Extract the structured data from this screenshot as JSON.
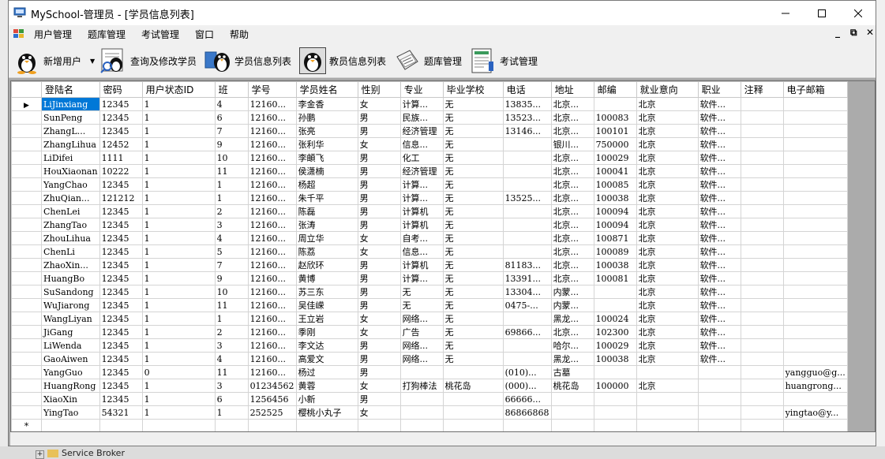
{
  "window": {
    "title": "MySchool-管理员 - [学员信息列表]"
  },
  "menu": [
    "用户管理",
    "题库管理",
    "考试管理",
    "窗口",
    "帮助"
  ],
  "mdi_controls": {
    "minimize": "_",
    "restore": "⧉",
    "close": "✕"
  },
  "toolbar": [
    {
      "label": "新增用户",
      "icon": "penguin-user-icon",
      "has_dropdown": true
    },
    {
      "label": "查询及修改学员",
      "icon": "penguin-search-icon"
    },
    {
      "label": "学员信息列表",
      "icon": "penguin-list-icon"
    },
    {
      "label": "教员信息列表",
      "icon": "penguin-teacher-icon"
    },
    {
      "label": "题库管理",
      "icon": "question-bank-icon"
    },
    {
      "label": "考试管理",
      "icon": "exam-sheet-icon"
    }
  ],
  "background": {
    "bottom_tree_item": "Service Broker"
  },
  "grid": {
    "columns": [
      "登陆名",
      "密码",
      "用户状态ID",
      "班",
      "学号",
      "学员姓名",
      "性别",
      "专业",
      "毕业学校",
      "电话",
      "地址",
      "邮编",
      "就业意向",
      "职业",
      "注释",
      "电子邮箱"
    ],
    "new_row_marker": "*",
    "current_row_marker": "▶",
    "rows": [
      [
        "LiJinxiang",
        "12345",
        "1",
        "4",
        "12160...",
        "李金香",
        "女",
        "计算...",
        "无",
        "13835...",
        "北京...",
        "",
        "北京",
        "软件...",
        "",
        ""
      ],
      [
        "SunPeng",
        "12345",
        "1",
        "6",
        "12160...",
        "孙鹏",
        "男",
        "民族...",
        "无",
        "13523...",
        "北京...",
        "100083",
        "北京",
        "软件...",
        "",
        ""
      ],
      [
        "ZhangL...",
        "12345",
        "1",
        "7",
        "12160...",
        "张亮",
        "男",
        "经济管理",
        "无",
        "13146...",
        "北京...",
        "100101",
        "北京",
        "软件...",
        "",
        ""
      ],
      [
        "ZhangLihua",
        "12452",
        "1",
        "9",
        "12160...",
        "张利华",
        "女",
        "信息...",
        "无",
        "",
        "银川...",
        "750000",
        "北京",
        "软件...",
        "",
        ""
      ],
      [
        "LiDifei",
        "1111",
        "1",
        "10",
        "12160...",
        "李頔飞",
        "男",
        "化工",
        "无",
        "",
        "北京...",
        "100029",
        "北京",
        "软件...",
        "",
        ""
      ],
      [
        "HouXiaonan",
        "10222",
        "1",
        "11",
        "12160...",
        "侯潇楠",
        "男",
        "经济管理",
        "无",
        "",
        "北京...",
        "100041",
        "北京",
        "软件...",
        "",
        ""
      ],
      [
        "YangChao",
        "12345",
        "1",
        "1",
        "12160...",
        "杨超",
        "男",
        "计算...",
        "无",
        "",
        "北京...",
        "100085",
        "北京",
        "软件...",
        "",
        ""
      ],
      [
        "ZhuQian...",
        "121212",
        "1",
        "1",
        "12160...",
        "朱千平",
        "男",
        "计算...",
        "无",
        "13525...",
        "北京...",
        "100038",
        "北京",
        "软件...",
        "",
        ""
      ],
      [
        "ChenLei",
        "12345",
        "1",
        "2",
        "12160...",
        "陈磊",
        "男",
        "计算机",
        "无",
        "",
        "北京...",
        "100094",
        "北京",
        "软件...",
        "",
        ""
      ],
      [
        "ZhangTao",
        "12345",
        "1",
        "3",
        "12160...",
        "张涛",
        "男",
        "计算机",
        "无",
        "",
        "北京...",
        "100094",
        "北京",
        "软件...",
        "",
        ""
      ],
      [
        "ZhouLihua",
        "12345",
        "1",
        "4",
        "12160...",
        "周立华",
        "女",
        "自考...",
        "无",
        "",
        "北京...",
        "100871",
        "北京",
        "软件...",
        "",
        ""
      ],
      [
        "ChenLi",
        "12345",
        "1",
        "5",
        "12160...",
        "陈荔",
        "女",
        "信息...",
        "无",
        "",
        "北京...",
        "100089",
        "北京",
        "软件...",
        "",
        ""
      ],
      [
        "ZhaoXin...",
        "12345",
        "1",
        "7",
        "12160...",
        "赵欣环",
        "男",
        "计算机",
        "无",
        "81183...",
        "北京...",
        "100038",
        "北京",
        "软件...",
        "",
        ""
      ],
      [
        "HuangBo",
        "12345",
        "1",
        "9",
        "12160...",
        "黄博",
        "男",
        "计算...",
        "无",
        "13391...",
        "北京...",
        "100081",
        "北京",
        "软件...",
        "",
        ""
      ],
      [
        "SuSandong",
        "12345",
        "1",
        "10",
        "12160...",
        "苏三东",
        "男",
        "无",
        "无",
        "13304...",
        "内蒙...",
        "",
        "北京",
        "软件...",
        "",
        ""
      ],
      [
        "WuJiarong",
        "12345",
        "1",
        "11",
        "12160...",
        "吴佳嵘",
        "男",
        "无",
        "无",
        "0475-...",
        "内蒙...",
        "",
        "北京",
        "软件...",
        "",
        ""
      ],
      [
        "WangLiyan",
        "12345",
        "1",
        "1",
        "12160...",
        "王立岩",
        "女",
        "网络...",
        "无",
        "",
        "黑龙...",
        "100024",
        "北京",
        "软件...",
        "",
        ""
      ],
      [
        "JiGang",
        "12345",
        "1",
        "2",
        "12160...",
        "季刚",
        "女",
        "广告",
        "无",
        "69866...",
        "北京...",
        "102300",
        "北京",
        "软件...",
        "",
        ""
      ],
      [
        "LiWenda",
        "12345",
        "1",
        "3",
        "12160...",
        "李文达",
        "男",
        "网络...",
        "无",
        "",
        "哈尔...",
        "100029",
        "北京",
        "软件...",
        "",
        ""
      ],
      [
        "GaoAiwen",
        "12345",
        "1",
        "4",
        "12160...",
        "高爱文",
        "男",
        "网络...",
        "无",
        "",
        "黑龙...",
        "100038",
        "北京",
        "软件...",
        "",
        ""
      ],
      [
        "YangGuo",
        "12345",
        "0",
        "11",
        "12160...",
        "杨过",
        "男",
        "",
        "",
        "(010)...",
        "古墓",
        "",
        "",
        "",
        "",
        "yangguo@g..."
      ],
      [
        "HuangRong",
        "12345",
        "1",
        "3",
        "01234562",
        "黄蓉",
        "女",
        "打狗棒法",
        "桃花岛",
        "(000)...",
        "桃花岛",
        "100000",
        "北京",
        "",
        "",
        "huangrong..."
      ],
      [
        "XiaoXin",
        "12345",
        "1",
        "6",
        "1256456",
        "小新",
        "男",
        "",
        "",
        "66666...",
        "",
        "",
        "",
        "",
        "",
        ""
      ],
      [
        "YingTao",
        "54321",
        "1",
        "1",
        "252525",
        "樱桃小丸子",
        "女",
        "",
        "",
        "86866868",
        "",
        "",
        "",
        "",
        "",
        "yingtao@y..."
      ]
    ]
  }
}
